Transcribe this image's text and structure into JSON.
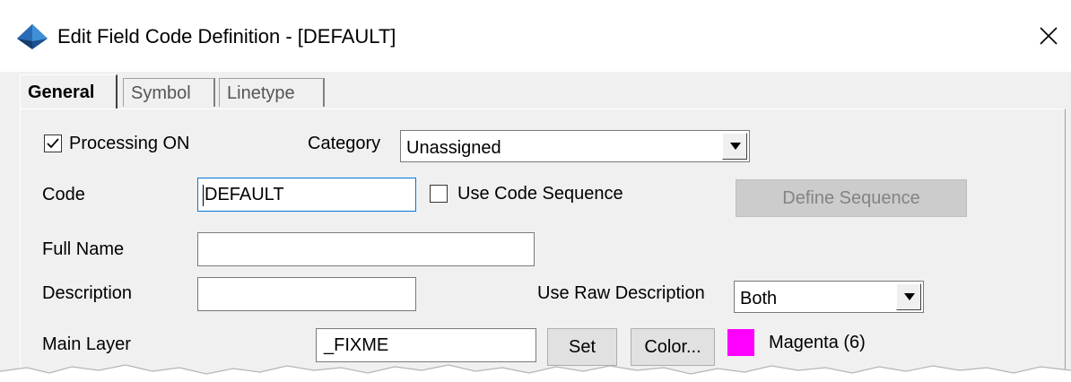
{
  "window": {
    "title": "Edit Field Code Definition - [DEFAULT]",
    "app_icon": "diamond-app-icon",
    "close_icon": "close-icon"
  },
  "tabs": [
    {
      "label": "General",
      "active": true
    },
    {
      "label": "Symbol",
      "active": false
    },
    {
      "label": "Linetype",
      "active": false
    }
  ],
  "general": {
    "processing_on": {
      "label": "Processing ON",
      "checked": true
    },
    "category": {
      "label": "Category",
      "value": "Unassigned"
    },
    "code": {
      "label": "Code",
      "value": "DEFAULT"
    },
    "use_code_sequence": {
      "label": "Use Code Sequence",
      "checked": false
    },
    "define_sequence": {
      "label": "Define Sequence",
      "enabled": false
    },
    "full_name": {
      "label": "Full Name",
      "value": ""
    },
    "description": {
      "label": "Description",
      "value": ""
    },
    "use_raw_description": {
      "label": "Use Raw Description",
      "value": "Both"
    },
    "main_layer": {
      "label": "Main Layer",
      "value": "_FIXME"
    },
    "set_button": "Set",
    "color_button": "Color...",
    "color": {
      "name": "Magenta (6)",
      "hex": "#ff00ff"
    }
  },
  "colors": {
    "icon_blue_dark": "#1e4f8f",
    "icon_blue_light": "#3f8fd8",
    "focus_border": "#0078d7",
    "disabled_button": "#cccccc"
  }
}
